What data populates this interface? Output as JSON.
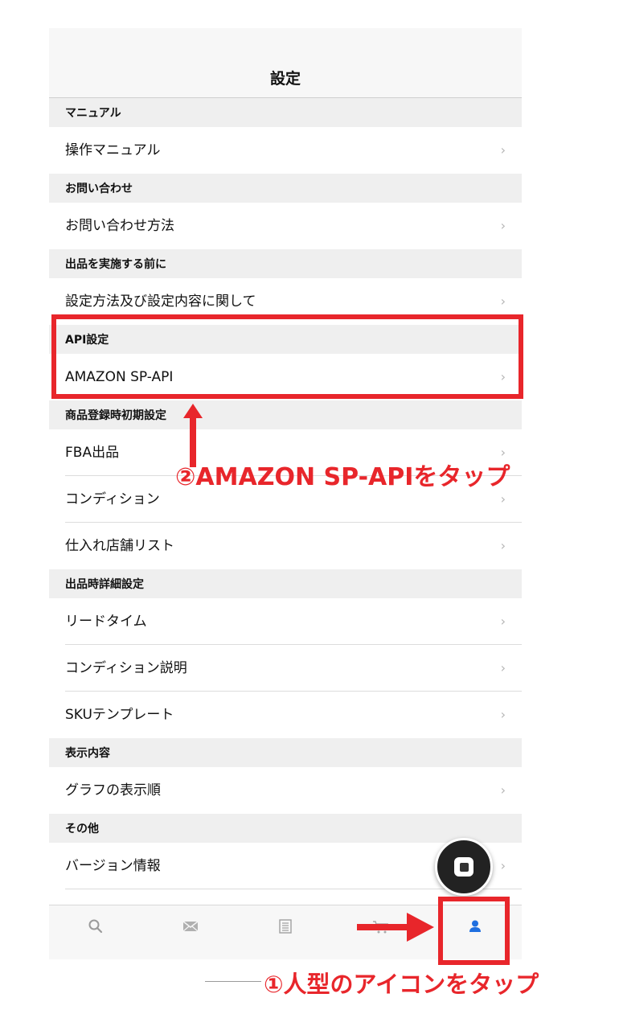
{
  "header": {
    "title": "設定"
  },
  "sections": [
    {
      "title": "マニュアル",
      "items": [
        "操作マニュアル"
      ]
    },
    {
      "title": "お問い合わせ",
      "items": [
        "お問い合わせ方法"
      ]
    },
    {
      "title": "出品を実施する前に",
      "items": [
        "設定方法及び設定内容に関して"
      ]
    },
    {
      "title": "API設定",
      "items": [
        "AMAZON SP-API"
      ]
    },
    {
      "title": "商品登録時初期設定",
      "items": [
        "FBA出品",
        "コンディション",
        "仕入れ店舗リスト"
      ]
    },
    {
      "title": "出品時詳細設定",
      "items": [
        "リードタイム",
        "コンディション説明",
        "SKUテンプレート"
      ]
    },
    {
      "title": "表示内容",
      "items": [
        "グラフの表示順"
      ]
    },
    {
      "title": "その他",
      "items": [
        "バージョン情報"
      ]
    }
  ],
  "chevron": "›",
  "tabbar": {
    "tabs": [
      {
        "name": "search-tab",
        "icon": "search-icon",
        "active": false
      },
      {
        "name": "mail-tab",
        "icon": "mail-icon",
        "active": false
      },
      {
        "name": "list-tab",
        "icon": "list-icon",
        "active": false
      },
      {
        "name": "cart-tab",
        "icon": "cart-icon",
        "active": false
      },
      {
        "name": "profile-tab",
        "icon": "person-icon",
        "active": true
      }
    ]
  },
  "annotations": {
    "step2": "②AMAZON SP-APIをタップ",
    "step1": "①人型のアイコンをタップ",
    "color": "#e8262b"
  },
  "colors": {
    "active_tab": "#1f6fe0",
    "inactive_tab": "#9a9a9a",
    "section_bg": "#efefef"
  }
}
